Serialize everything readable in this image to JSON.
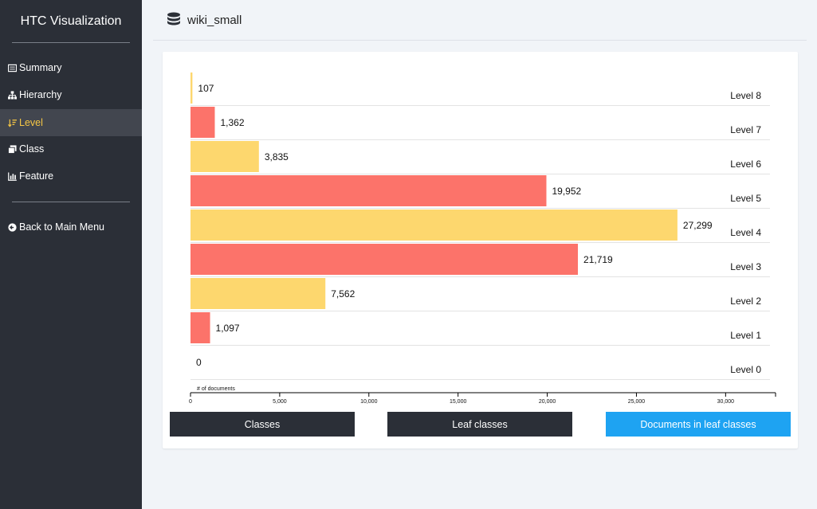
{
  "app": {
    "title": "HTC Visualization"
  },
  "sidebar": {
    "items": [
      {
        "label": "Summary",
        "icon": "list-icon"
      },
      {
        "label": "Hierarchy",
        "icon": "sitemap-icon"
      },
      {
        "label": "Level",
        "icon": "sort-icon",
        "active": true
      },
      {
        "label": "Class",
        "icon": "clone-icon"
      },
      {
        "label": "Feature",
        "icon": "bar-chart-icon"
      }
    ],
    "back_label": "Back to Main Menu"
  },
  "header": {
    "dataset": "wiki_small"
  },
  "colors": {
    "yellow": "#fdd76e",
    "red": "#fc736a",
    "accent": "#f5c645",
    "blue": "#1ea3f2",
    "sidebar": "#2b2f37"
  },
  "chart_data": {
    "type": "bar",
    "orientation": "horizontal",
    "categories": [
      "Level 8",
      "Level 7",
      "Level 6",
      "Level 5",
      "Level 4",
      "Level 3",
      "Level 2",
      "Level 1",
      "Level 0"
    ],
    "values": [
      107,
      1362,
      3835,
      19952,
      27299,
      21719,
      7562,
      1097,
      0
    ],
    "value_labels": [
      "107",
      "1,362",
      "3,835",
      "19,952",
      "27,299",
      "21,719",
      "7,562",
      "1,097",
      "0"
    ],
    "xlabel": "# of documents",
    "xlim": [
      0,
      32800
    ],
    "xticks": [
      0,
      5000,
      10000,
      15000,
      20000,
      25000,
      30000
    ],
    "xtick_labels": [
      "0",
      "5,000",
      "10,000",
      "15,000",
      "20,000",
      "25,000",
      "30,000"
    ],
    "bar_colors": [
      "#fdd76e",
      "#fc736a",
      "#fdd76e",
      "#fc736a",
      "#fdd76e",
      "#fc736a",
      "#fdd76e",
      "#fc736a",
      "#fdd76e"
    ]
  },
  "buttons": {
    "classes": "Classes",
    "leaf_classes": "Leaf classes",
    "documents_in_leaf": "Documents in leaf classes"
  }
}
